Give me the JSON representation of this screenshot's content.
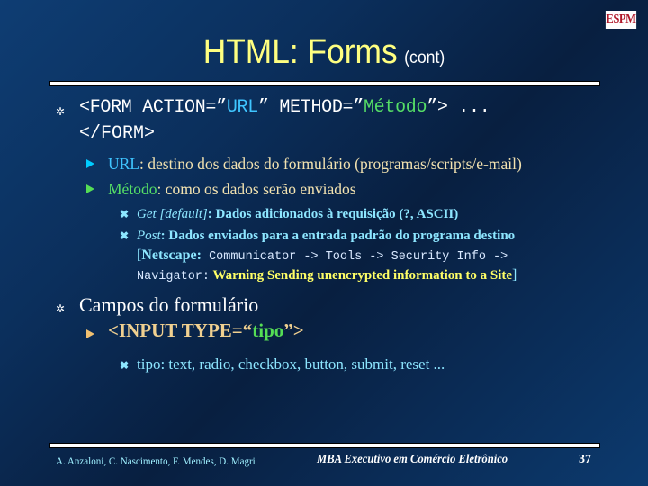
{
  "logo": {
    "text": "ESPM"
  },
  "title": {
    "main": "HTML: Forms",
    "suffix": "(cont)"
  },
  "bullets": [
    {
      "code": {
        "prefix": "<FORM ACTION=”",
        "url": "URL",
        "mid": "” METHOD=”",
        "method": "Método",
        "suffix": "”> ...",
        "line2": "</FORM>"
      },
      "sub": [
        {
          "term": "URL",
          "text": ": destino dos dados do formulário (programas/scripts/e-mail)",
          "arrow_color": "#00ccff"
        },
        {
          "term": "Método",
          "text": ": como os dados serão enviados",
          "arrow_color": "#55dd55"
        }
      ],
      "subsub": [
        {
          "term": "Get [default]",
          "text": ": Dados adicionados à requisição (?, ASCII)"
        },
        {
          "term": "Post",
          "text": ": Dados enviados para a entrada padrão do programa destino"
        }
      ],
      "note": {
        "open": "[",
        "label": "Netscape:",
        "path": " Communicator -> Tools -> Security Info ->",
        "nav": "Navigator:",
        "warning": " Warning Sending unencrypted information to a Site",
        "close": "]"
      }
    },
    {
      "text": "Campos do formulário",
      "sub": [
        {
          "prefix": "<INPUT TYPE=“",
          "value": "tipo",
          "suffix": "”>",
          "arrow_color": "#f0c070"
        }
      ],
      "subsub": [
        {
          "text": "tipo: text, radio, checkbox, button, submit, reset ..."
        }
      ]
    }
  ],
  "footer": {
    "authors": "A. Anzaloni, C. Nascimento, F. Mendes, D. Magri",
    "course": "MBA Executivo em Comércio Eletrônico",
    "page": "37"
  }
}
